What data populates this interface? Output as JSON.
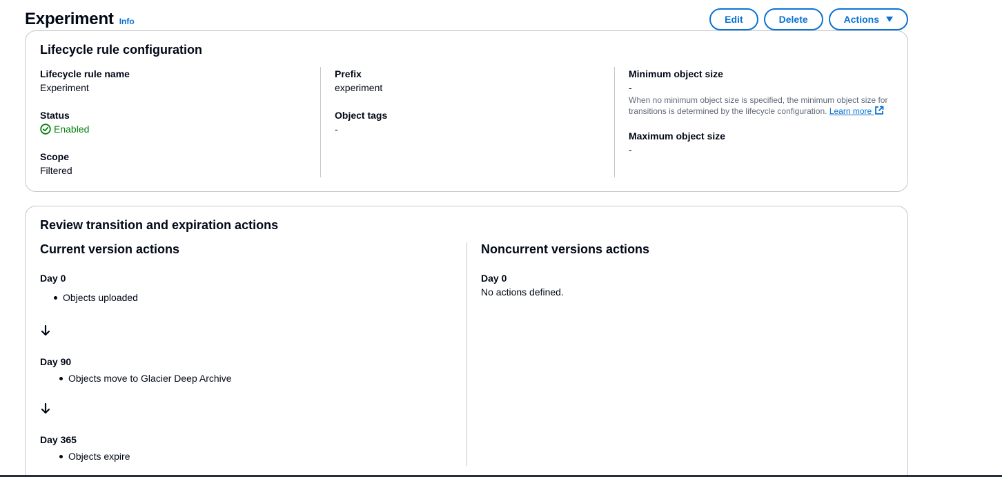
{
  "header": {
    "title": "Experiment",
    "info": "Info",
    "buttons": {
      "edit": "Edit",
      "delete": "Delete",
      "actions": "Actions"
    }
  },
  "config": {
    "title": "Lifecycle rule configuration",
    "rule_name": {
      "label": "Lifecycle rule name",
      "value": "Experiment"
    },
    "status": {
      "label": "Status",
      "value": "Enabled",
      "color": "#037f0c"
    },
    "scope": {
      "label": "Scope",
      "value": "Filtered"
    },
    "prefix": {
      "label": "Prefix",
      "value": "experiment"
    },
    "tags": {
      "label": "Object tags",
      "value": "-"
    },
    "min_size": {
      "label": "Minimum object size",
      "value": "-",
      "description": "When no minimum object size is specified, the minimum object size for transitions is determined by the lifecycle configuration.",
      "learn_more": "Learn more"
    },
    "max_size": {
      "label": "Maximum object size",
      "value": "-"
    }
  },
  "review": {
    "title": "Review transition and expiration actions",
    "current": {
      "title": "Current version actions",
      "steps": [
        {
          "day": "Day 0",
          "item": "Objects uploaded"
        },
        {
          "day": "Day 90",
          "item": "Objects move to Glacier Deep Archive"
        },
        {
          "day": "Day 365",
          "item": "Objects expire"
        }
      ]
    },
    "noncurrent": {
      "title": "Noncurrent versions actions",
      "day": "Day 0",
      "text": "No actions defined."
    }
  },
  "colors": {
    "accent": "#0972d3",
    "success": "#037f0c",
    "border": "#c6c6cd"
  }
}
